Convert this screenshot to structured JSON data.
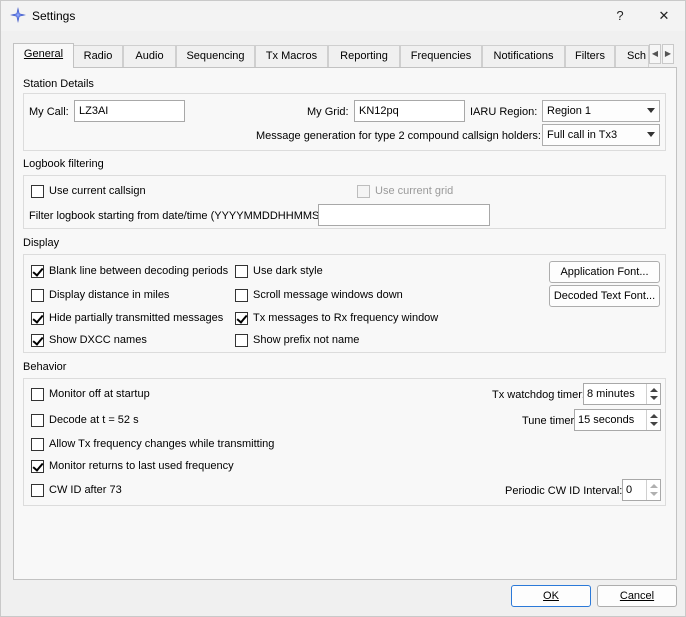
{
  "window": {
    "title": "Settings",
    "help_glyph": "?",
    "close_glyph": "✕"
  },
  "tabs": [
    "General",
    "Radio",
    "Audio",
    "Sequencing",
    "Tx Macros",
    "Reporting",
    "Frequencies",
    "Notifications",
    "Filters",
    "Sch"
  ],
  "tab_scroll": {
    "left": "◀",
    "right": "▶"
  },
  "station": {
    "title": "Station Details",
    "my_call_label": "My Call:",
    "my_call_value": "LZ3AI",
    "my_grid_label": "My Grid:",
    "my_grid_value": "KN12pq",
    "iaru_label": "IARU Region:",
    "iaru_value": "Region 1",
    "msg_gen_label": "Message generation for type 2 compound callsign holders:",
    "msg_gen_value": "Full call in Tx3"
  },
  "logbook": {
    "title": "Logbook filtering",
    "use_callsign": {
      "label": "Use current callsign",
      "checked": false
    },
    "use_grid": {
      "label": "Use current grid",
      "checked": false,
      "disabled": true
    },
    "filter_label": "Filter logbook starting from date/time (YYYYMMDDHHMMSS)",
    "filter_value": ""
  },
  "display": {
    "title": "Display",
    "left": [
      {
        "label": "Blank line between decoding periods",
        "checked": true
      },
      {
        "label": "Display distance in miles",
        "checked": false
      },
      {
        "label": "Hide partially transmitted messages",
        "checked": true
      },
      {
        "label": "Show DXCC names",
        "checked": true
      }
    ],
    "mid": [
      {
        "label": "Use dark style",
        "checked": false
      },
      {
        "label": "Scroll message windows down",
        "checked": false
      },
      {
        "label": "Tx messages to Rx frequency window",
        "checked": true
      },
      {
        "label": "Show prefix not name",
        "checked": false
      }
    ],
    "app_font_button": "Application Font...",
    "decoded_font_button": "Decoded Text Font..."
  },
  "behavior": {
    "title": "Behavior",
    "items": [
      {
        "label": "Monitor off at startup",
        "checked": false
      },
      {
        "label": "Decode at t = 52 s",
        "checked": false
      },
      {
        "label": "Allow Tx frequency changes while transmitting",
        "checked": false
      },
      {
        "label": "Monitor returns to last used frequency",
        "checked": true
      },
      {
        "label": "CW ID after 73",
        "checked": false
      }
    ],
    "tx_watchdog_label": "Tx watchdog timer:",
    "tx_watchdog_value": "8 minutes",
    "tune_timer_label": "Tune timer:",
    "tune_timer_value": "15 seconds",
    "cw_interval_label": "Periodic CW ID Interval:",
    "cw_interval_value": "0"
  },
  "footer": {
    "ok": "OK",
    "cancel": "Cancel"
  },
  "colors": {
    "accent": "#2b79d8",
    "icon": "#3a55c8"
  }
}
